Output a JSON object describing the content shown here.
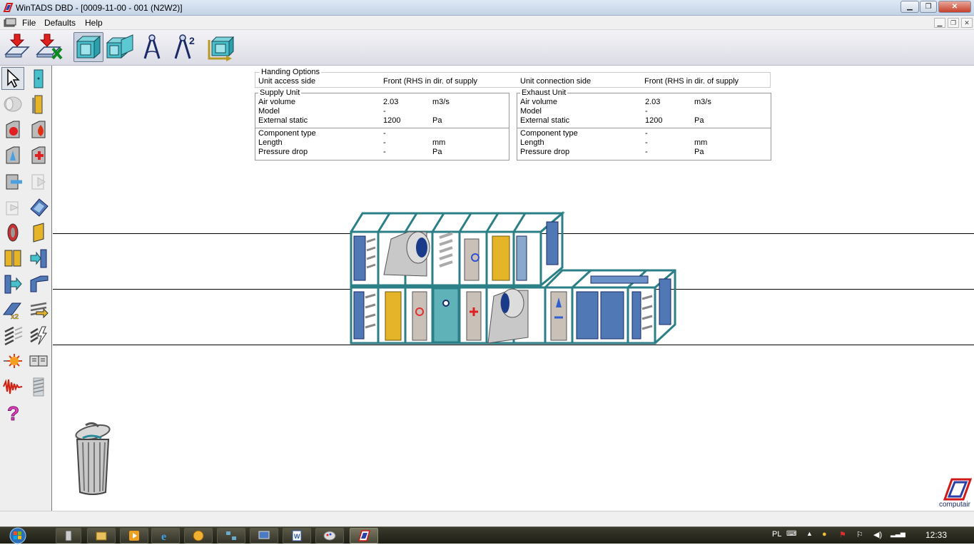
{
  "window": {
    "title": "WinTADS DBD - [0009-11-00 - 001 (N2W2)]"
  },
  "menu": {
    "items": [
      "File",
      "Defaults",
      "Help"
    ]
  },
  "toolbar": {
    "icons": [
      "new-unit-icon",
      "delete-unit-icon",
      "single-tier-unit-icon",
      "double-tier-unit-icon",
      "drawing-compass-icon",
      "compass-2-icon",
      "unit-rotate-icon"
    ]
  },
  "handing": {
    "legend": "Handing Options",
    "access_label": "Unit access side",
    "access_value": "Front (RHS in dir. of supply",
    "connection_label": "Unit connection side",
    "connection_value": "Front (RHS in dir. of supply"
  },
  "supply": {
    "legend": "Supply Unit",
    "air_volume_label": "Air volume",
    "air_volume_value": "2.03",
    "air_volume_unit": "m3/s",
    "model_label": "Model",
    "model_value": "-",
    "static_label": "External static",
    "static_value": "1200",
    "static_unit": "Pa",
    "component_label": "Component type",
    "component_value": "-",
    "length_label": "Length",
    "length_value": "-",
    "length_unit": "mm",
    "pdrop_label": "Pressure drop",
    "pdrop_value": "-",
    "pdrop_unit": "Pa"
  },
  "exhaust": {
    "legend": "Exhaust Unit",
    "air_volume_label": "Air volume",
    "air_volume_value": "2.03",
    "air_volume_unit": "m3/s",
    "model_label": "Model",
    "model_value": "-",
    "static_label": "External static",
    "static_value": "1200",
    "static_unit": "Pa",
    "component_label": "Component type",
    "component_value": "-",
    "length_label": "Length",
    "length_value": "-",
    "length_unit": "mm",
    "pdrop_label": "Pressure drop",
    "pdrop_value": "-",
    "pdrop_unit": "Pa"
  },
  "brand": {
    "logo_text": "computair"
  },
  "taskbar": {
    "lang": "PL",
    "clock": "12:33"
  },
  "colors": {
    "frame": "#5fb3b8",
    "panel_blue": "#4f78b4",
    "accent_red": "#e03030",
    "filter_yellow": "#e6b428"
  }
}
